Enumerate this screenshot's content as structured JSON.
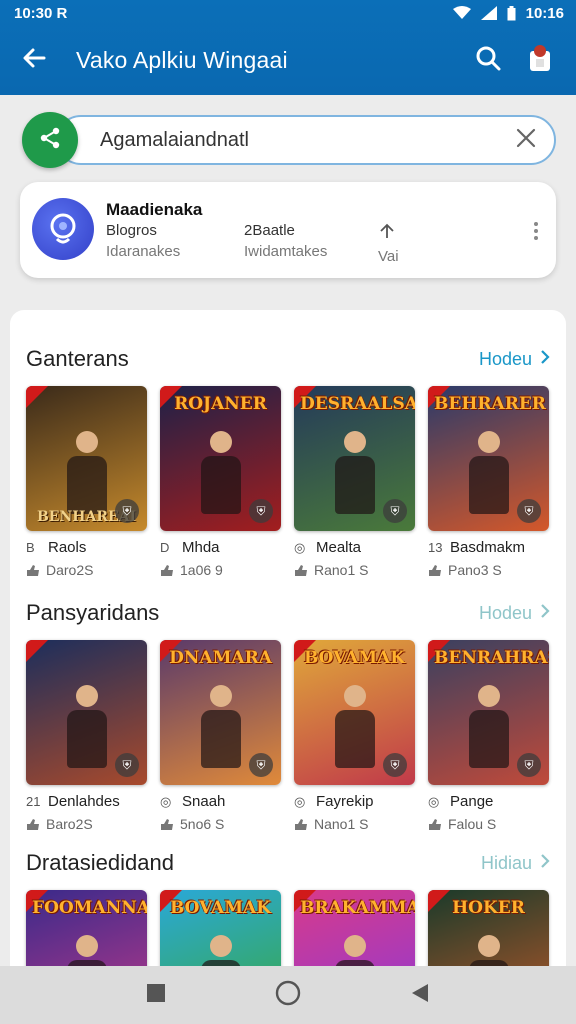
{
  "status": {
    "time": "10:30 R",
    "clock": "10:16"
  },
  "header": {
    "title": "Vako Aplkiu Wingaai",
    "back_icon": "back-arrow-icon",
    "search_icon": "search-icon",
    "profile_icon": "profile-icon"
  },
  "search": {
    "value": "Agamalaiandnatl",
    "share_icon": "share-icon",
    "clear_icon": "close-icon"
  },
  "app_card": {
    "name": "Maadienaka",
    "stats": [
      {
        "value": "Blogros",
        "label": "Idaranakes"
      },
      {
        "value": "2Baatle",
        "label": "Iwidamtakes"
      },
      {
        "value": "",
        "label": "Vai"
      }
    ]
  },
  "sections": [
    {
      "title": "Ganterans",
      "more": "Hodeu",
      "cards": [
        {
          "banner": "",
          "foot": "BENHAREAI",
          "name": "Raols",
          "prefix": "B",
          "sub": "Daro2S",
          "colors": [
            "#3a2a1a",
            "#c68a2c"
          ]
        },
        {
          "banner": "ROJANER",
          "foot": "",
          "name": "Mhda",
          "prefix": "D",
          "sub": "1a06 9",
          "colors": [
            "#1e2148",
            "#a31e1e"
          ]
        },
        {
          "banner": "DESRAALSA",
          "foot": "",
          "name": "Mealta",
          "prefix": "◎",
          "sub": "Rano1 S",
          "colors": [
            "#243a5a",
            "#4a7a3a"
          ]
        },
        {
          "banner": "BEHRARER",
          "foot": "",
          "name": "Basdmakm",
          "prefix": "13",
          "sub": "Pano3 S",
          "colors": [
            "#2a3a6a",
            "#d4582a"
          ]
        }
      ]
    },
    {
      "title": "Pansyaridans",
      "more": "Hodeu",
      "cards": [
        {
          "banner": "",
          "foot": "",
          "name": "Denlahdes",
          "prefix": "21",
          "sub": "Baro2S",
          "colors": [
            "#1c2e5c",
            "#a84a2c"
          ]
        },
        {
          "banner": "DNAMARA",
          "foot": "",
          "name": "Snaah",
          "prefix": "◎",
          "sub": "5no6 S",
          "colors": [
            "#5a3a6a",
            "#e08a3a"
          ]
        },
        {
          "banner": "BOVAMAK",
          "foot": "",
          "name": "Fayrekip",
          "prefix": "◎",
          "sub": "Nano1 S",
          "colors": [
            "#e0a83a",
            "#c03a4a"
          ]
        },
        {
          "banner": "BENRAHRAS",
          "foot": "",
          "name": "Pange",
          "prefix": "◎",
          "sub": "Falou S",
          "colors": [
            "#3a4060",
            "#c04a3a"
          ]
        }
      ]
    },
    {
      "title": "Dratasiedidand",
      "more": "Hidiau",
      "cards": [
        {
          "banner": "FOOMANNA",
          "foot": "",
          "name": "",
          "prefix": "",
          "sub": "",
          "colors": [
            "#3a2a8a",
            "#c03a8a"
          ]
        },
        {
          "banner": "BOVAMAK",
          "foot": "",
          "name": "",
          "prefix": "",
          "sub": "",
          "colors": [
            "#2aa8d8",
            "#3aa83a"
          ]
        },
        {
          "banner": "BRAKAMMA",
          "foot": "",
          "name": "",
          "prefix": "",
          "sub": "",
          "colors": [
            "#d83a8a",
            "#8a3ad8"
          ]
        },
        {
          "banner": "HOKER",
          "foot": "",
          "name": "",
          "prefix": "",
          "sub": "",
          "colors": [
            "#1a3a2a",
            "#c05a2a"
          ]
        }
      ]
    }
  ],
  "nav": {
    "recents_icon": "square-icon",
    "home_icon": "circle-icon",
    "back_icon": "triangle-back-icon"
  }
}
